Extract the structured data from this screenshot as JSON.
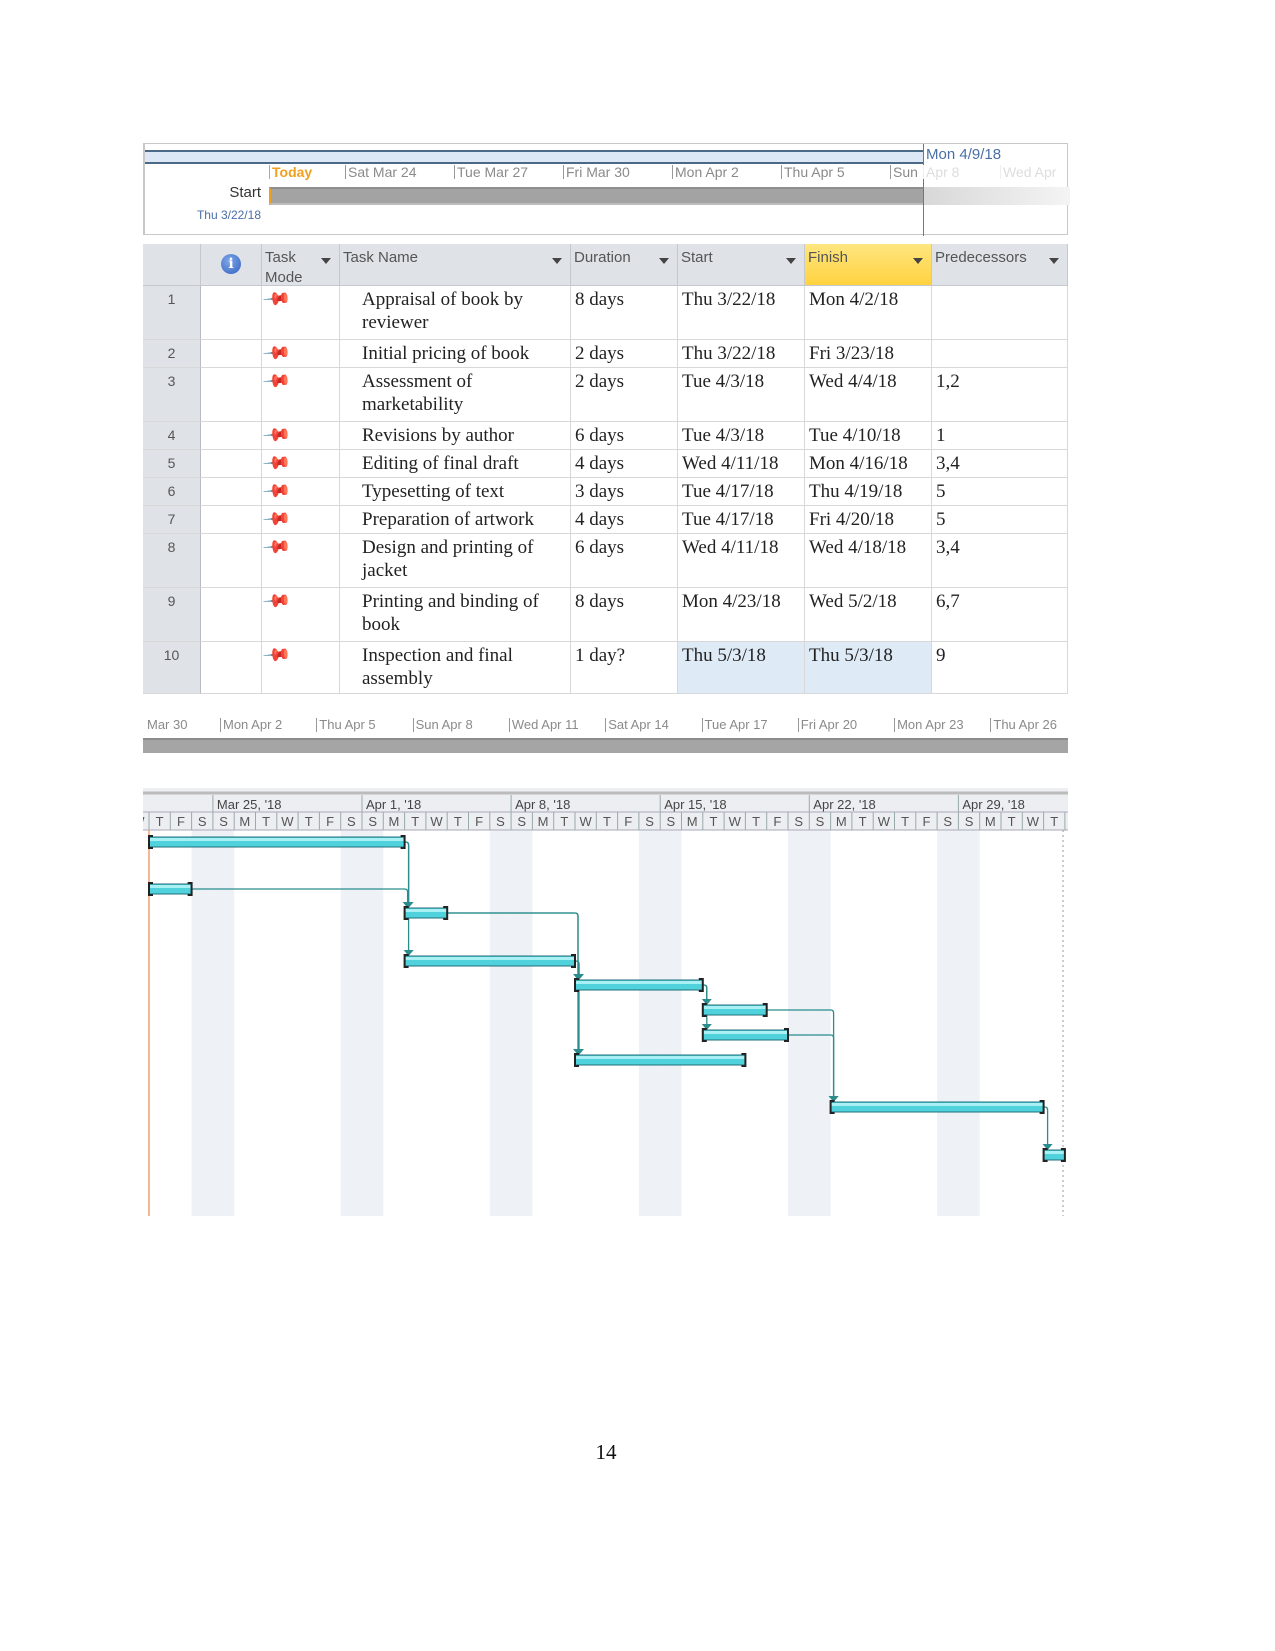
{
  "timeline": {
    "today_label": "Today",
    "start_label": "Start",
    "start_date": "Thu 3/22/18",
    "current_date": "Mon 4/9/18",
    "ticks": [
      "Sat Mar 24",
      "Tue Mar 27",
      "Fri Mar 30",
      "Mon Apr 2",
      "Thu Apr 5",
      "Sun"
    ],
    "faded_ticks": [
      "Apr 8",
      "Wed Apr"
    ]
  },
  "table": {
    "headers": {
      "info": "info-icon",
      "task_mode": "Task Mode",
      "task_name": "Task Name",
      "duration": "Duration",
      "start": "Start",
      "finish": "Finish",
      "predecessors": "Predecessors"
    },
    "rows": [
      {
        "id": "1",
        "name": "Appraisal of book by reviewer",
        "duration": "8 days",
        "start": "Thu 3/22/18",
        "finish": "Mon 4/2/18",
        "pred": ""
      },
      {
        "id": "2",
        "name": "Initial pricing of book",
        "duration": "2 days",
        "start": "Thu 3/22/18",
        "finish": "Fri 3/23/18",
        "pred": ""
      },
      {
        "id": "3",
        "name": "Assessment of marketability",
        "duration": "2 days",
        "start": "Tue 4/3/18",
        "finish": "Wed 4/4/18",
        "pred": "1,2"
      },
      {
        "id": "4",
        "name": "Revisions by author",
        "duration": "6 days",
        "start": "Tue 4/3/18",
        "finish": "Tue 4/10/18",
        "pred": "1"
      },
      {
        "id": "5",
        "name": "Editing of final draft",
        "duration": "4 days",
        "start": "Wed 4/11/18",
        "finish": "Mon 4/16/18",
        "pred": "3,4"
      },
      {
        "id": "6",
        "name": "Typesetting of text",
        "duration": "3 days",
        "start": "Tue 4/17/18",
        "finish": "Thu 4/19/18",
        "pred": "5"
      },
      {
        "id": "7",
        "name": "Preparation of artwork",
        "duration": "4 days",
        "start": "Tue 4/17/18",
        "finish": "Fri 4/20/18",
        "pred": "5"
      },
      {
        "id": "8",
        "name": "Design and printing of jacket",
        "duration": "6 days",
        "start": "Wed 4/11/18",
        "finish": "Wed 4/18/18",
        "pred": "3,4"
      },
      {
        "id": "9",
        "name": "Printing and binding of book",
        "duration": "8 days",
        "start": "Mon 4/23/18",
        "finish": "Wed 5/2/18",
        "pred": "6,7"
      },
      {
        "id": "10",
        "name": "Inspection and final assembly",
        "duration": "1 day?",
        "start": "Thu 5/3/18",
        "finish": "Thu 5/3/18",
        "pred": "9"
      }
    ],
    "task_mode_icon": "pushpin-icon"
  },
  "strip_ticks": [
    "Mar 30",
    "Mon Apr 2",
    "Thu Apr 5",
    "Sun Apr 8",
    "Wed Apr 11",
    "Sat Apr 14",
    "Tue Apr 17",
    "Fri Apr 20",
    "Mon Apr 23",
    "Thu Apr 26"
  ],
  "gantt": {
    "weeks": [
      "Mar 25, '18",
      "Apr 1, '18",
      "Apr 8, '18",
      "Apr 15, '18",
      "Apr 22, '18",
      "Apr 29, '18"
    ],
    "day_letters": [
      "S",
      "M",
      "T",
      "W",
      "T",
      "F",
      "S"
    ],
    "colors": {
      "bar": "#4fd2dc",
      "link": "#2a8c8c",
      "today_line": "#f0a070",
      "weekend": "#eef1f6",
      "finish_header": "#ffd84a"
    }
  },
  "page_number": "14"
}
